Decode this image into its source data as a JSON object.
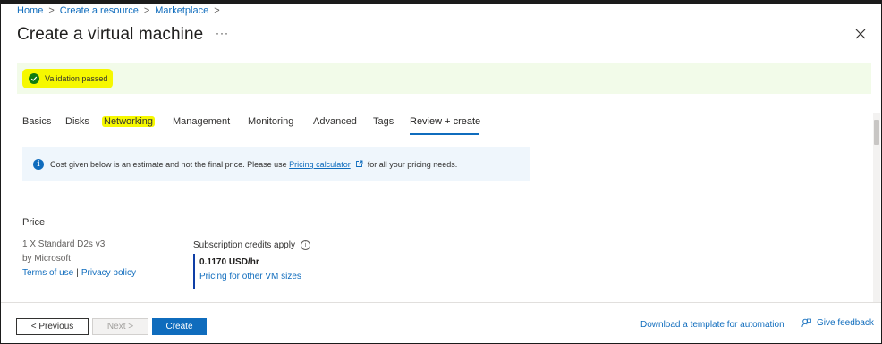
{
  "breadcrumb": {
    "items": [
      "Home",
      "Create a resource",
      "Marketplace"
    ],
    "separator": ">"
  },
  "page": {
    "title": "Create a virtual machine",
    "more_label": "···"
  },
  "validation": {
    "message": "Validation passed",
    "status_color": "#107c10"
  },
  "tabs": [
    {
      "label": "Basics"
    },
    {
      "label": "Disks"
    },
    {
      "label": "Networking"
    },
    {
      "label": "Management"
    },
    {
      "label": "Monitoring"
    },
    {
      "label": "Advanced"
    },
    {
      "label": "Tags"
    },
    {
      "label": "Review + create"
    }
  ],
  "active_tab": "Review + create",
  "info": {
    "text_before": "Cost given below is an estimate and not the final price. Please use",
    "link_label": "Pricing calculator",
    "text_after": "for all your pricing needs."
  },
  "price": {
    "title": "Price",
    "vm": "1 X Standard D2s v3",
    "by": "by Microsoft",
    "terms_label": "Terms of use",
    "pipe": "|",
    "privacy_label": "Privacy policy",
    "subscription_label": "Subscription credits apply",
    "help_glyph": "i",
    "value": "0.1170 USD/hr",
    "other_sizes_label": "Pricing for other VM sizes"
  },
  "footer": {
    "previous_label": "< Previous",
    "next_label": "Next >",
    "create_label": "Create",
    "download_label": "Download a template for automation",
    "feedback_label": "Give feedback"
  },
  "colors": {
    "accent": "#0f6cbd",
    "highlight": "#f6f800",
    "success_bg": "#f2fbe9"
  }
}
